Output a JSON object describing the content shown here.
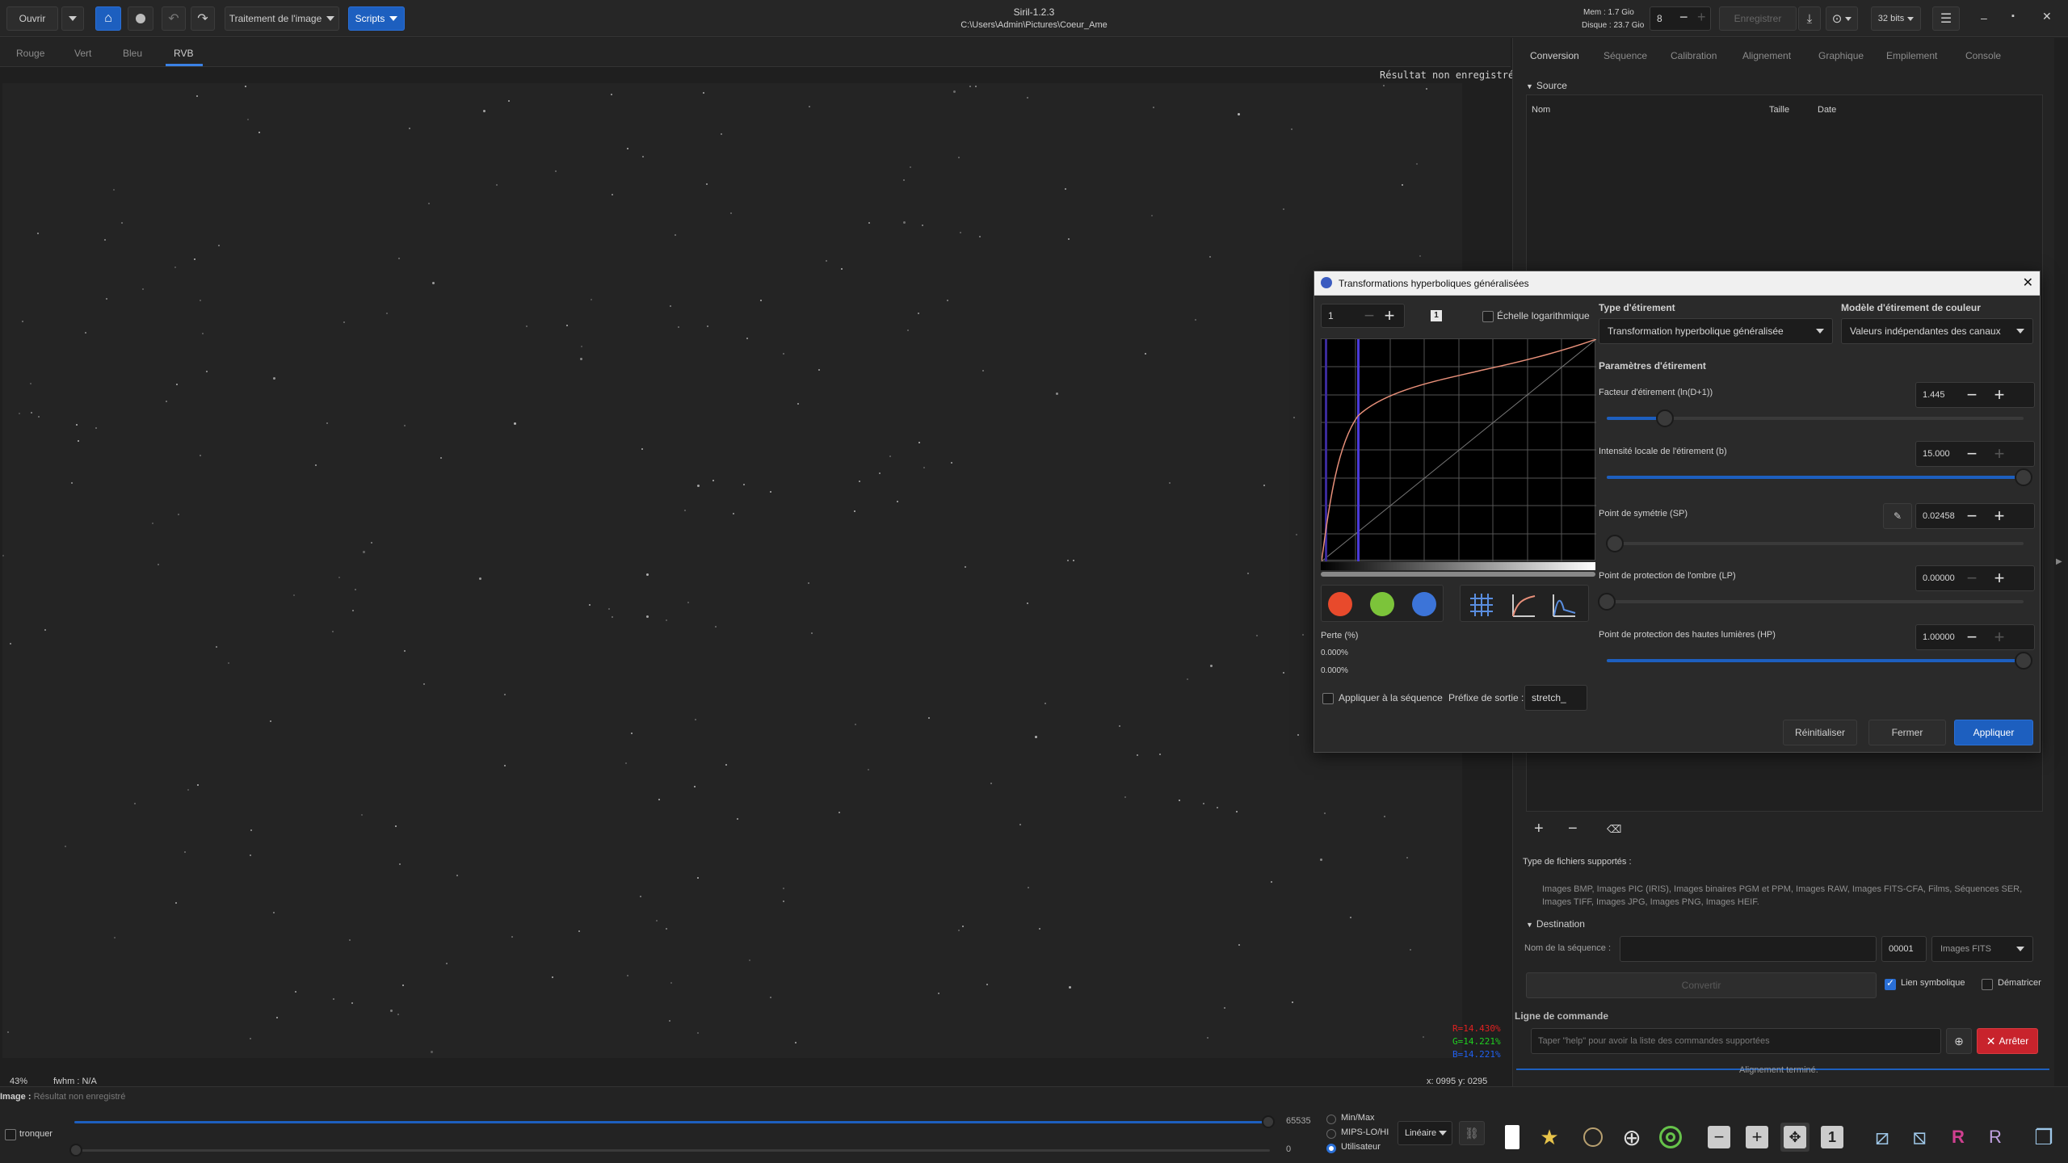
{
  "app": {
    "title": "Siril-1.2.3",
    "path": "C:\\Users\\Admin\\Pictures\\Coeur_Ame"
  },
  "topbar": {
    "open_label": "Ouvrir",
    "image_processing_label": "Traitement de l'image",
    "scripts_label": "Scripts",
    "mem_label": "Mem : 1.7 Gio",
    "disk_label": "Disque : 23.7 Gio",
    "threads_value": "8",
    "save_label": "Enregistrer",
    "bitdepth_label": "32 bits"
  },
  "view_tabs": [
    "Rouge",
    "Vert",
    "Bleu",
    "RVB"
  ],
  "canvas": {
    "status_overlay": "Résultat non enregistré"
  },
  "right_tabs": [
    "Conversion",
    "Séquence",
    "Calibration",
    "Alignement",
    "Graphique",
    "Empilement",
    "Console"
  ],
  "conversion": {
    "source_header": "Source",
    "columns": [
      "Nom",
      "Taille",
      "Date"
    ],
    "supported_header": "Type de fichiers supportés :",
    "supported_text": "Images BMP, Images PIC (IRIS), Images binaires PGM et PPM, Images RAW, Images FITS-CFA, Films, Séquences SER, Images TIFF, Images JPG, Images PNG, Images HEIF.",
    "destination_header": "Destination",
    "seq_name_label": "Nom de la séquence :",
    "seq_index": "00001",
    "output_type": "Images FITS",
    "convert_label": "Convertir",
    "symlink_label": "Lien symbolique",
    "debayer_label": "Dématricer"
  },
  "command": {
    "header": "Ligne de commande",
    "placeholder": "Taper \"help\" pour avoir la liste des commandes supportées",
    "stop_label": "Arrêter",
    "status": "Alignement terminé."
  },
  "dialog": {
    "title": "Transformations hyperboliques généralisées",
    "zoom_value": "1",
    "log_scale_label": "Échelle logarithmique",
    "stretch_type_header": "Type d'étirement",
    "stretch_type_value": "Transformation hyperbolique généralisée",
    "color_model_header": "Modèle d'étirement de couleur",
    "color_model_value": "Valeurs indépendantes des canaux",
    "params_header": "Paramètres d'étirement",
    "params": [
      {
        "label": "Facteur d'étirement (ln(D+1))",
        "value": "1.445",
        "fraction": 0.14
      },
      {
        "label": "Intensité locale de l'étirement (b)",
        "value": "15.000",
        "fraction": 1.0
      },
      {
        "label": "Point de symétrie (SP)",
        "value": "0.02458",
        "fraction": 0.02
      },
      {
        "label": "Point de protection de l'ombre (LP)",
        "value": "0.00000",
        "fraction": 0.0
      },
      {
        "label": "Point de protection des hautes lumières (HP)",
        "value": "1.00000",
        "fraction": 1.0
      }
    ],
    "loss_label": "Perte (%)",
    "loss_values": [
      "0.000%",
      "0.000%"
    ],
    "apply_sequence_label": "Appliquer à la séquence",
    "prefix_label": "Préfixe de sortie :",
    "prefix_value": "stretch_",
    "reset_label": "Réinitialiser",
    "close_label": "Fermer",
    "apply_label": "Appliquer"
  },
  "status": {
    "zoom": "43%",
    "fwhm": "fwhm  :  N/A",
    "coords": "x: 0995  y: 0295",
    "r": "R=14.430%",
    "g": "G=14.221%",
    "b": "B=14.221%",
    "image_label": "Image :",
    "image_status": "Résultat non enregistré"
  },
  "bottom": {
    "clip_label": "tronquer",
    "max_value": "65535",
    "min_value": "0",
    "modes": [
      "Min/Max",
      "MIPS-LO/HI",
      "Utilisateur"
    ],
    "scale_label": "Linéaire"
  },
  "colors": {
    "accent": "#1d5fbf",
    "stop": "#c8232c",
    "curve": "#e8907a"
  }
}
